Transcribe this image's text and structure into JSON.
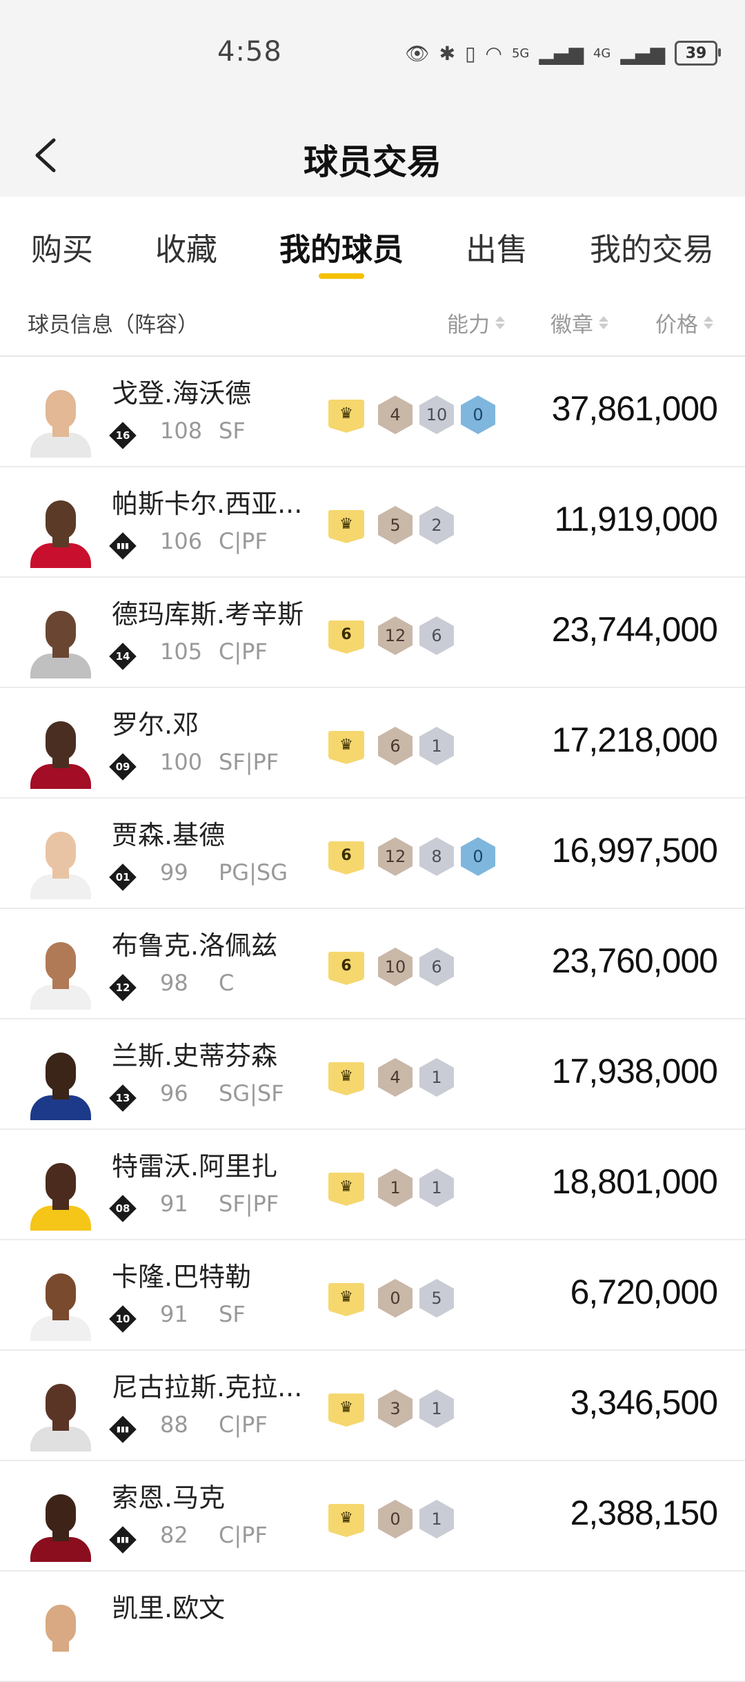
{
  "status_bar": {
    "time": "4:58",
    "battery": "39",
    "net1": "5G",
    "net2": "4G"
  },
  "page": {
    "title": "球员交易"
  },
  "tabs": [
    "购买",
    "收藏",
    "我的球员",
    "出售",
    "我的交易"
  ],
  "active_tab": "我的球员",
  "columns": {
    "info": "球员信息（阵容）",
    "ability": "能力",
    "badges": "徽章",
    "price": "价格"
  },
  "players": [
    {
      "name": "戈登.海沃德",
      "rank": "16",
      "ovr": "108",
      "pos": "SF",
      "tier": "crown",
      "badges": [
        "4",
        "10",
        "0"
      ],
      "price": "37,861,000"
    },
    {
      "name": "帕斯卡尔.西亚...",
      "rank": "",
      "ovr": "106",
      "pos": "C|PF",
      "tier": "crown",
      "badges": [
        "5",
        "2"
      ],
      "price": "11,919,000"
    },
    {
      "name": "德玛库斯.考辛斯",
      "rank": "14",
      "ovr": "105",
      "pos": "C|PF",
      "tier": "6",
      "badges": [
        "12",
        "6"
      ],
      "price": "23,744,000"
    },
    {
      "name": "罗尔.邓",
      "rank": "09",
      "ovr": "100",
      "pos": "SF|PF",
      "tier": "crown",
      "badges": [
        "6",
        "1"
      ],
      "price": "17,218,000"
    },
    {
      "name": "贾森.基德",
      "rank": "01",
      "ovr": "99",
      "pos": "PG|SG",
      "tier": "6",
      "badges": [
        "12",
        "8",
        "0"
      ],
      "price": "16,997,500"
    },
    {
      "name": "布鲁克.洛佩兹",
      "rank": "12",
      "ovr": "98",
      "pos": "C",
      "tier": "6",
      "badges": [
        "10",
        "6"
      ],
      "price": "23,760,000"
    },
    {
      "name": "兰斯.史蒂芬森",
      "rank": "13",
      "ovr": "96",
      "pos": "SG|SF",
      "tier": "crown",
      "badges": [
        "4",
        "1"
      ],
      "price": "17,938,000"
    },
    {
      "name": "特雷沃.阿里扎",
      "rank": "08",
      "ovr": "91",
      "pos": "SF|PF",
      "tier": "crown",
      "badges": [
        "1",
        "1"
      ],
      "price": "18,801,000"
    },
    {
      "name": "卡隆.巴特勒",
      "rank": "10",
      "ovr": "91",
      "pos": "SF",
      "tier": "crown",
      "badges": [
        "0",
        "5"
      ],
      "price": "6,720,000"
    },
    {
      "name": "尼古拉斯.克拉...",
      "rank": "",
      "ovr": "88",
      "pos": "C|PF",
      "tier": "crown",
      "badges": [
        "3",
        "1"
      ],
      "price": "3,346,500"
    },
    {
      "name": "索恩.马克",
      "rank": "",
      "ovr": "82",
      "pos": "C|PF",
      "tier": "crown",
      "badges": [
        "0",
        "1"
      ],
      "price": "2,388,150"
    },
    {
      "name": "凯里.欧文",
      "rank": "",
      "ovr": "",
      "pos": "",
      "tier": "",
      "badges": [],
      "price": ""
    }
  ]
}
